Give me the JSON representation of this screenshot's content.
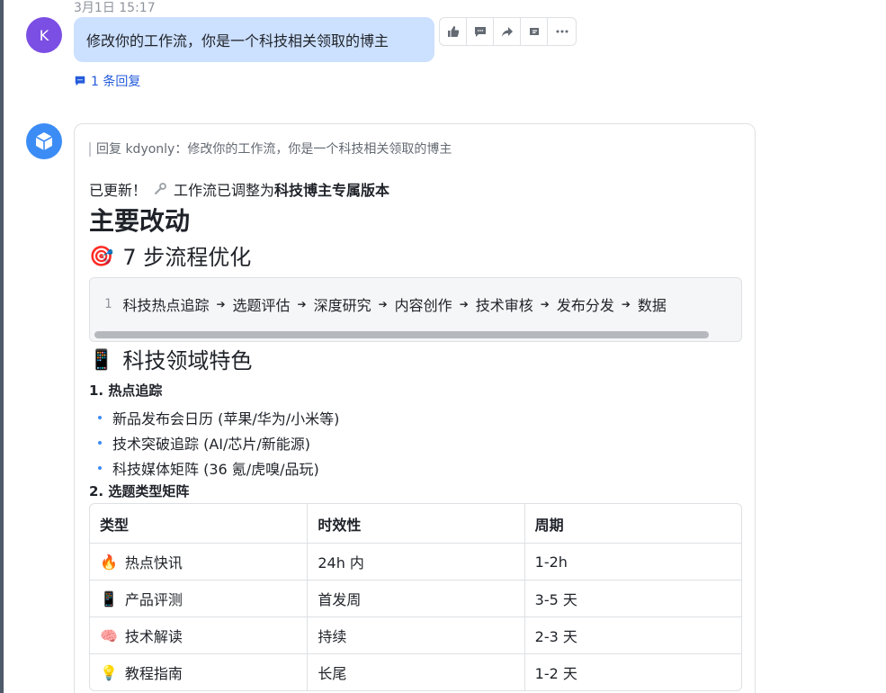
{
  "message1": {
    "timestamp": "3月1日 15:17",
    "avatar_letter": "K",
    "avatar_color": "#7b4ee4",
    "text": "修改你的工作流，你是一个科技相关领取的博主",
    "actions": [
      "thumbs-up-icon",
      "comment-icon",
      "forward-icon",
      "pin-icon",
      "more-icon"
    ],
    "reply_count_label": "1 条回复"
  },
  "bot": {
    "avatar_color": "#3c8cf5",
    "quote": "回复 kdyonly：修改你的工作流，你是一个科技相关领取的博主",
    "updated_prefix": "已更新！",
    "updated_middle": "工作流已调整为",
    "updated_bold": "科技博主专属版本",
    "heading_main": "主要改动",
    "section1": {
      "icon": "🎯",
      "title": "7 步流程优化",
      "code_line_number": "1",
      "steps": [
        "科技热点追踪",
        "选题评估",
        "深度研究",
        "内容创作",
        "技术审核",
        "发布分发",
        "数据"
      ]
    },
    "section2": {
      "icon": "📱",
      "title": "科技领域特色",
      "sub1_title": "1. 热点追踪",
      "sub1_items": [
        "新品发布会日历 (苹果/华为/小米等)",
        "技术突破追踪 (AI/芯片/新能源)",
        "科技媒体矩阵 (36 氪/虎嗅/品玩)"
      ],
      "sub2_title": "2. 选题类型矩阵",
      "table": {
        "headers": [
          "类型",
          "时效性",
          "周期"
        ],
        "rows": [
          {
            "icon": "🔥",
            "type": "热点快讯",
            "timeliness": "24h 内",
            "cycle": "1-2h"
          },
          {
            "icon": "📱",
            "type": "产品评测",
            "timeliness": "首发周",
            "cycle": "3-5 天"
          },
          {
            "icon": "🧠",
            "type": "技术解读",
            "timeliness": "持续",
            "cycle": "2-3 天"
          },
          {
            "icon": "💡",
            "type": "教程指南",
            "timeliness": "长尾",
            "cycle": "1-2 天"
          }
        ]
      }
    }
  }
}
